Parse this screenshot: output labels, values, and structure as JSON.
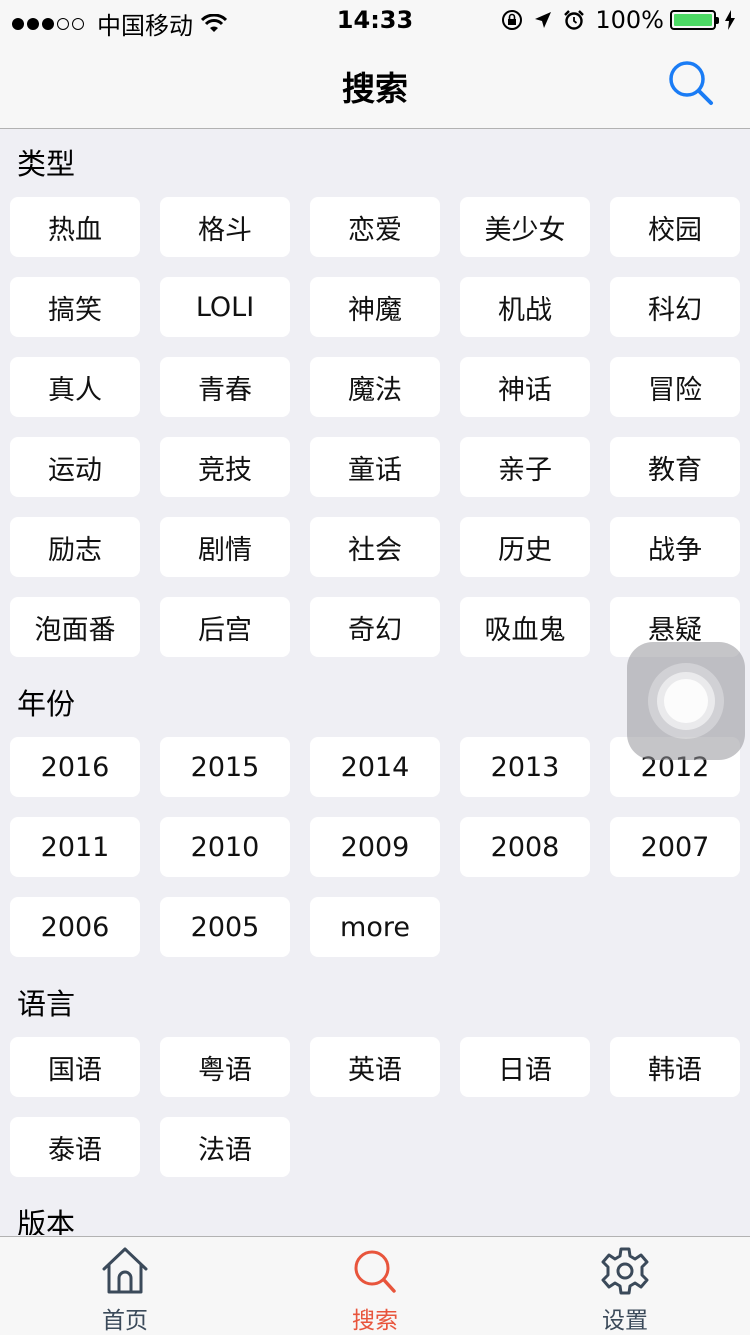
{
  "status_bar": {
    "carrier": "中国移动",
    "time": "14:33",
    "battery_percent": "100%"
  },
  "nav": {
    "title": "搜索"
  },
  "sections": {
    "type": {
      "title": "类型",
      "tags": [
        "热血",
        "格斗",
        "恋爱",
        "美少女",
        "校园",
        "搞笑",
        "LOLI",
        "神魔",
        "机战",
        "科幻",
        "真人",
        "青春",
        "魔法",
        "神话",
        "冒险",
        "运动",
        "竞技",
        "童话",
        "亲子",
        "教育",
        "励志",
        "剧情",
        "社会",
        "历史",
        "战争",
        "泡面番",
        "后宫",
        "奇幻",
        "吸血鬼",
        "悬疑"
      ]
    },
    "year": {
      "title": "年份",
      "tags": [
        "2016",
        "2015",
        "2014",
        "2013",
        "2012",
        "2011",
        "2010",
        "2009",
        "2008",
        "2007",
        "2006",
        "2005",
        "more"
      ]
    },
    "language": {
      "title": "语言",
      "tags": [
        "国语",
        "粤语",
        "英语",
        "日语",
        "韩语",
        "泰语",
        "法语"
      ]
    },
    "version": {
      "title": "版本"
    }
  },
  "tab_bar": {
    "items": [
      {
        "label": "首页",
        "icon": "home-icon",
        "active": false
      },
      {
        "label": "搜索",
        "icon": "search-icon",
        "active": true
      },
      {
        "label": "设置",
        "icon": "gear-icon",
        "active": false
      }
    ],
    "active_color": "#e8553c",
    "inactive_color": "#3b4a5a"
  },
  "colors": {
    "accent": "#1a7cf5",
    "background": "#efeff4",
    "battery": "#4cd964"
  }
}
